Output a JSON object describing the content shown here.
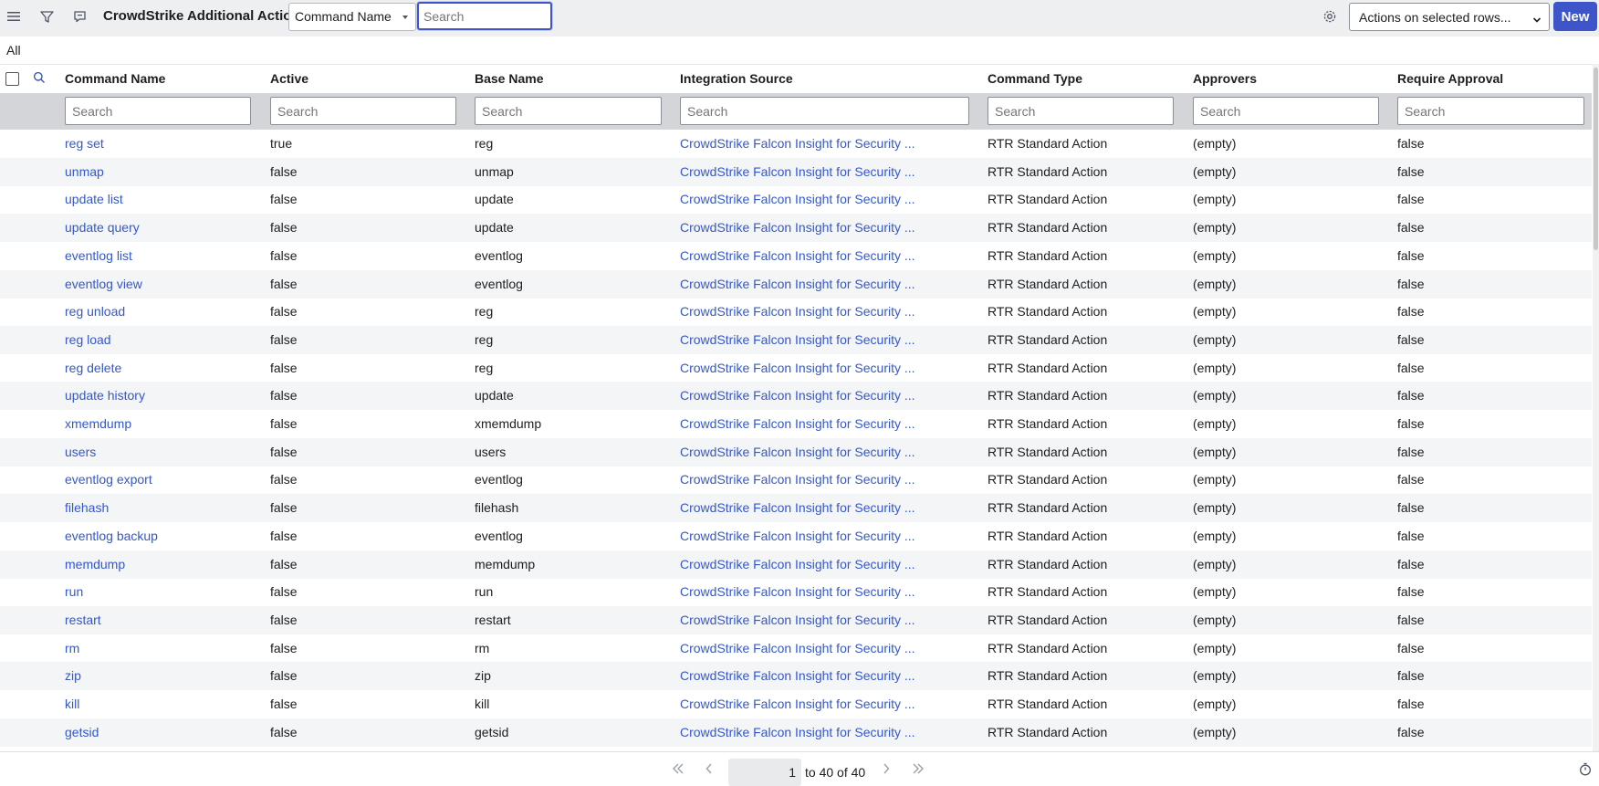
{
  "header": {
    "title": "CrowdStrike Additional Actions",
    "field_select": "Command Name",
    "search_placeholder": "Search",
    "actions_select": "Actions on selected rows...",
    "new_label": "New"
  },
  "breadcrumb": "All",
  "columns": [
    "Command Name",
    "Active",
    "Base Name",
    "Integration Source",
    "Command Type",
    "Approvers",
    "Require Approval"
  ],
  "filter_placeholder": "Search",
  "rows": [
    {
      "name": "reg set",
      "active": "true",
      "base": "reg",
      "source": "CrowdStrike Falcon Insight for Security ...",
      "type": "RTR Standard Action",
      "approvers": "(empty)",
      "require": "false"
    },
    {
      "name": "unmap",
      "active": "false",
      "base": "unmap",
      "source": "CrowdStrike Falcon Insight for Security ...",
      "type": "RTR Standard Action",
      "approvers": "(empty)",
      "require": "false"
    },
    {
      "name": "update list",
      "active": "false",
      "base": "update",
      "source": "CrowdStrike Falcon Insight for Security ...",
      "type": "RTR Standard Action",
      "approvers": "(empty)",
      "require": "false"
    },
    {
      "name": "update query",
      "active": "false",
      "base": "update",
      "source": "CrowdStrike Falcon Insight for Security ...",
      "type": "RTR Standard Action",
      "approvers": "(empty)",
      "require": "false"
    },
    {
      "name": "eventlog list",
      "active": "false",
      "base": "eventlog",
      "source": "CrowdStrike Falcon Insight for Security ...",
      "type": "RTR Standard Action",
      "approvers": "(empty)",
      "require": "false"
    },
    {
      "name": "eventlog view",
      "active": "false",
      "base": "eventlog",
      "source": "CrowdStrike Falcon Insight for Security ...",
      "type": "RTR Standard Action",
      "approvers": "(empty)",
      "require": "false"
    },
    {
      "name": "reg unload",
      "active": "false",
      "base": "reg",
      "source": "CrowdStrike Falcon Insight for Security ...",
      "type": "RTR Standard Action",
      "approvers": "(empty)",
      "require": "false"
    },
    {
      "name": "reg load",
      "active": "false",
      "base": "reg",
      "source": "CrowdStrike Falcon Insight for Security ...",
      "type": "RTR Standard Action",
      "approvers": "(empty)",
      "require": "false"
    },
    {
      "name": "reg delete",
      "active": "false",
      "base": "reg",
      "source": "CrowdStrike Falcon Insight for Security ...",
      "type": "RTR Standard Action",
      "approvers": "(empty)",
      "require": "false"
    },
    {
      "name": "update history",
      "active": "false",
      "base": "update",
      "source": "CrowdStrike Falcon Insight for Security ...",
      "type": "RTR Standard Action",
      "approvers": "(empty)",
      "require": "false"
    },
    {
      "name": "xmemdump",
      "active": "false",
      "base": "xmemdump",
      "source": "CrowdStrike Falcon Insight for Security ...",
      "type": "RTR Standard Action",
      "approvers": "(empty)",
      "require": "false"
    },
    {
      "name": "users",
      "active": "false",
      "base": "users",
      "source": "CrowdStrike Falcon Insight for Security ...",
      "type": "RTR Standard Action",
      "approvers": "(empty)",
      "require": "false"
    },
    {
      "name": "eventlog export",
      "active": "false",
      "base": "eventlog",
      "source": "CrowdStrike Falcon Insight for Security ...",
      "type": "RTR Standard Action",
      "approvers": "(empty)",
      "require": "false"
    },
    {
      "name": "filehash",
      "active": "false",
      "base": "filehash",
      "source": "CrowdStrike Falcon Insight for Security ...",
      "type": "RTR Standard Action",
      "approvers": "(empty)",
      "require": "false"
    },
    {
      "name": "eventlog backup",
      "active": "false",
      "base": "eventlog",
      "source": "CrowdStrike Falcon Insight for Security ...",
      "type": "RTR Standard Action",
      "approvers": "(empty)",
      "require": "false"
    },
    {
      "name": "memdump",
      "active": "false",
      "base": "memdump",
      "source": "CrowdStrike Falcon Insight for Security ...",
      "type": "RTR Standard Action",
      "approvers": "(empty)",
      "require": "false"
    },
    {
      "name": "run",
      "active": "false",
      "base": "run",
      "source": "CrowdStrike Falcon Insight for Security ...",
      "type": "RTR Standard Action",
      "approvers": "(empty)",
      "require": "false"
    },
    {
      "name": "restart",
      "active": "false",
      "base": "restart",
      "source": "CrowdStrike Falcon Insight for Security ...",
      "type": "RTR Standard Action",
      "approvers": "(empty)",
      "require": "false"
    },
    {
      "name": "rm",
      "active": "false",
      "base": "rm",
      "source": "CrowdStrike Falcon Insight for Security ...",
      "type": "RTR Standard Action",
      "approvers": "(empty)",
      "require": "false"
    },
    {
      "name": "zip",
      "active": "false",
      "base": "zip",
      "source": "CrowdStrike Falcon Insight for Security ...",
      "type": "RTR Standard Action",
      "approvers": "(empty)",
      "require": "false"
    },
    {
      "name": "kill",
      "active": "false",
      "base": "kill",
      "source": "CrowdStrike Falcon Insight for Security ...",
      "type": "RTR Standard Action",
      "approvers": "(empty)",
      "require": "false"
    },
    {
      "name": "getsid",
      "active": "false",
      "base": "getsid",
      "source": "CrowdStrike Falcon Insight for Security ...",
      "type": "RTR Standard Action",
      "approvers": "(empty)",
      "require": "false"
    }
  ],
  "pagination": {
    "current_page": "1",
    "range_text": "to 40 of 40"
  },
  "icons": {
    "menu": "hamburger-menu-icon",
    "filter": "filter-icon",
    "comment": "comment-icon",
    "settings": "gear-icon",
    "search": "search-icon",
    "first": "first-page-icon",
    "prev": "prev-page-icon",
    "next": "next-page-icon",
    "last": "last-page-icon",
    "timer": "stopwatch-icon"
  },
  "colors": {
    "accent": "#3d55c9",
    "link": "#3458c9",
    "header_bg": "#eeeff1",
    "filter_row_bg": "#d3d5d9"
  }
}
